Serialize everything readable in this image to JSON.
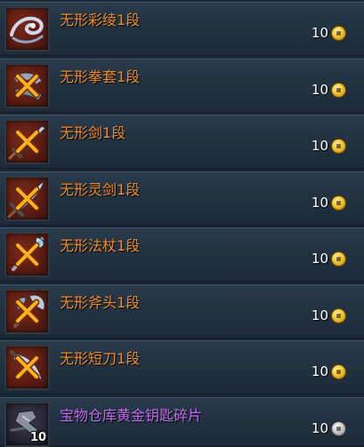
{
  "items": [
    {
      "name": "无形彩绫1段",
      "price": "10",
      "currency": "gold-coin",
      "icon": "ribbon-icon",
      "disabled_mark": false,
      "quality_color": "#f08c26"
    },
    {
      "name": "无形拳套1段",
      "price": "10",
      "currency": "gold-coin",
      "icon": "gauntlet-icon",
      "disabled_mark": true,
      "quality_color": "#f08c26"
    },
    {
      "name": "无形剑1段",
      "price": "10",
      "currency": "gold-coin",
      "icon": "sword-icon",
      "disabled_mark": true,
      "quality_color": "#f08c26"
    },
    {
      "name": "无形灵剑1段",
      "price": "10",
      "currency": "gold-coin",
      "icon": "spirit-sword-icon",
      "disabled_mark": true,
      "quality_color": "#f08c26"
    },
    {
      "name": "无形法杖1段",
      "price": "10",
      "currency": "gold-coin",
      "icon": "staff-icon",
      "disabled_mark": true,
      "quality_color": "#f08c26"
    },
    {
      "name": "无形斧头1段",
      "price": "10",
      "currency": "gold-coin",
      "icon": "axe-icon",
      "disabled_mark": true,
      "quality_color": "#f08c26"
    },
    {
      "name": "无形短刀1段",
      "price": "10",
      "currency": "gold-coin",
      "icon": "dagger-icon",
      "disabled_mark": true,
      "quality_color": "#f08c26"
    },
    {
      "name": "宝物仓库黄金钥匙碎片",
      "price": "10",
      "currency": "silver-coin",
      "icon": "key-fragment-icon",
      "disabled_mark": false,
      "quality_color": "#c36df0",
      "stack_count": "10"
    }
  ]
}
